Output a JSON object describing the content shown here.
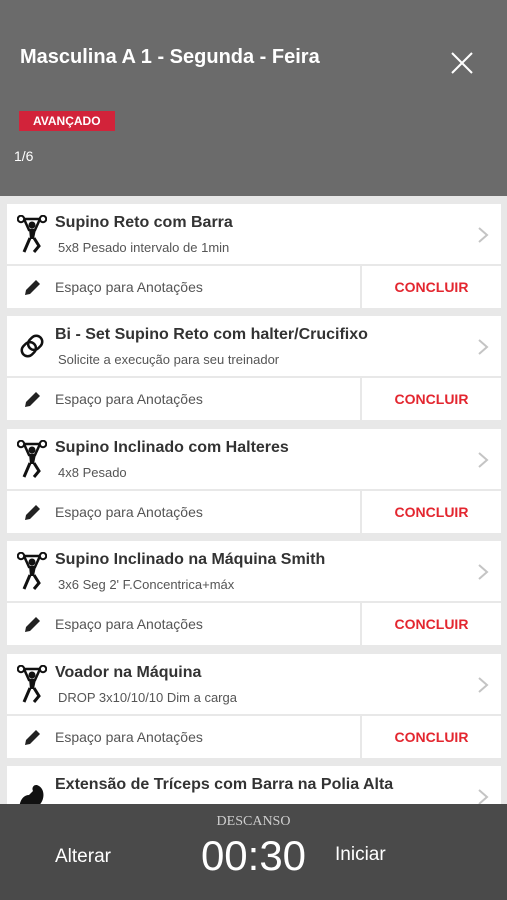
{
  "header": {
    "title": "Masculina A 1 - Segunda - Feira",
    "level_badge": "AVANÇADO",
    "progress": "1/6"
  },
  "colors": {
    "header_bg": "#6b6b6b",
    "accent": "#e3262f",
    "badge_bg": "#d2233a",
    "bottom_bar": "#4a4a4a"
  },
  "exercises": [
    {
      "name": "Supino Reto com Barra",
      "description": "5x8 Pesado intervalo de 1min",
      "icon": "weightlifter-icon",
      "note_placeholder": "Espaço para Anotações",
      "done_label": "CONCLUIR"
    },
    {
      "name": "Bi - Set Supino Reto com halter/Crucifixo",
      "description": "Solicite a execução para seu treinador",
      "icon": "link-icon",
      "note_placeholder": "Espaço para Anotações",
      "done_label": "CONCLUIR"
    },
    {
      "name": "Supino Inclinado com Halteres",
      "description": "4x8 Pesado",
      "icon": "weightlifter-icon",
      "note_placeholder": "Espaço para Anotações",
      "done_label": "CONCLUIR"
    },
    {
      "name": "Supino Inclinado na Máquina Smith",
      "description": "3x6 Seg 2' F.Concentrica+máx",
      "icon": "weightlifter-icon",
      "note_placeholder": "Espaço para Anotações",
      "done_label": "CONCLUIR"
    },
    {
      "name": "Voador na Máquina",
      "description": "DROP 3x10/10/10 Dim a carga",
      "icon": "weightlifter-icon",
      "note_placeholder": "Espaço para Anotações",
      "done_label": "CONCLUIR"
    },
    {
      "name": "Extensão de Tríceps com Barra  na Polia Alta",
      "description": "",
      "icon": "flexed-arm-icon",
      "note_placeholder": "",
      "done_label": ""
    }
  ],
  "rest_bar": {
    "change_label": "Alterar",
    "rest_label": "DESCANSO",
    "timer": "00:30",
    "start_label": "Iniciar"
  }
}
